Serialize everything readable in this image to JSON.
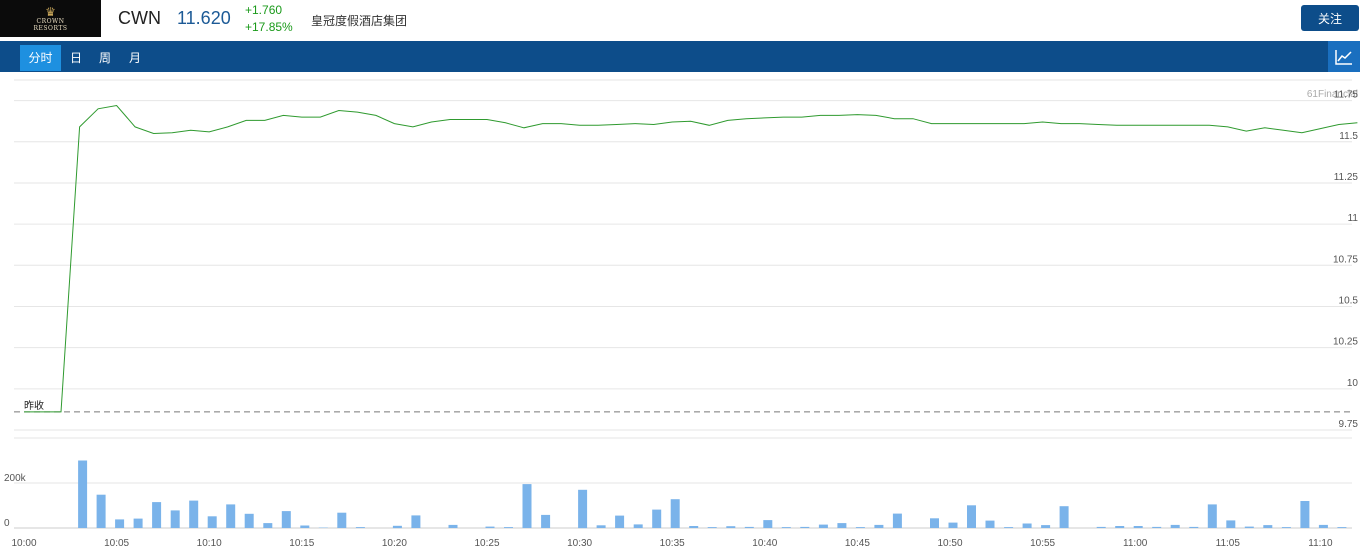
{
  "header": {
    "logo_line1": "CROWN",
    "logo_line2": "RESORTS",
    "symbol": "CWN",
    "price": "11.620",
    "change": "+1.760",
    "change_pct": "+17.85%",
    "company_name": "皇冠度假酒店集团",
    "follow_label": "关注"
  },
  "tabs": [
    {
      "label": "分时",
      "active": true
    },
    {
      "label": "日",
      "active": false
    },
    {
      "label": "周",
      "active": false
    },
    {
      "label": "月",
      "active": false
    }
  ],
  "colors": {
    "line": "#2f9a2f",
    "volume": "#7ab3ea",
    "nav": "#0d4d8a",
    "tab_active": "#1e90e0"
  },
  "chart_data": {
    "type": "line",
    "watermark": "61Financial",
    "prev_close_label": "昨收",
    "prev_close": 9.86,
    "y_ticks": [
      "11.75",
      "11.5",
      "11.25",
      "11",
      "10.75",
      "10.5",
      "10.25",
      "10",
      "9.75"
    ],
    "ylim": [
      9.75,
      11.875
    ],
    "x_ticks": [
      "10:00",
      "10:05",
      "10:10",
      "10:15",
      "10:20",
      "10:25",
      "10:30",
      "10:35",
      "10:40",
      "10:45",
      "10:50",
      "10:55",
      "11:00",
      "11:05",
      "11:10"
    ],
    "price": [
      9.86,
      9.86,
      9.86,
      11.59,
      11.7,
      11.72,
      11.59,
      11.55,
      11.555,
      11.57,
      11.56,
      11.59,
      11.63,
      11.63,
      11.66,
      11.65,
      11.65,
      11.69,
      11.68,
      11.66,
      11.61,
      11.59,
      11.62,
      11.635,
      11.635,
      11.635,
      11.615,
      11.585,
      11.61,
      11.61,
      11.6,
      11.6,
      11.605,
      11.61,
      11.605,
      11.62,
      11.625,
      11.6,
      11.63,
      11.64,
      11.645,
      11.65,
      11.65,
      11.66,
      11.66,
      11.665,
      11.66,
      11.64,
      11.64,
      11.61,
      11.61,
      11.61,
      11.61,
      11.61,
      11.61,
      11.62,
      11.61,
      11.61,
      11.605,
      11.6,
      11.6,
      11.6,
      11.6,
      11.6,
      11.6,
      11.59,
      11.565,
      11.585,
      11.57,
      11.555,
      11.58,
      11.605,
      11.615
    ],
    "volume_ticks": [
      "200k",
      "0"
    ],
    "volume_max": 400000,
    "volume": [
      0,
      0,
      0,
      300000,
      148000,
      38000,
      42000,
      115000,
      78000,
      122000,
      52000,
      105000,
      63000,
      22000,
      75000,
      11000,
      2000,
      68000,
      4000,
      0,
      10000,
      56000,
      0,
      14000,
      0,
      6000,
      4000,
      195000,
      58000,
      0,
      170000,
      12000,
      55000,
      16000,
      82000,
      128000,
      9000,
      4000,
      8000,
      5000,
      35000,
      4000,
      5000,
      15000,
      22000,
      4000,
      14000,
      64000,
      0,
      43000,
      24000,
      101000,
      33000,
      4000,
      20000,
      13000,
      97000,
      0,
      5000,
      9000,
      9000,
      5000,
      14000,
      5000,
      105000,
      34000,
      6000,
      13000,
      4000,
      120000,
      14000,
      4000
    ]
  }
}
